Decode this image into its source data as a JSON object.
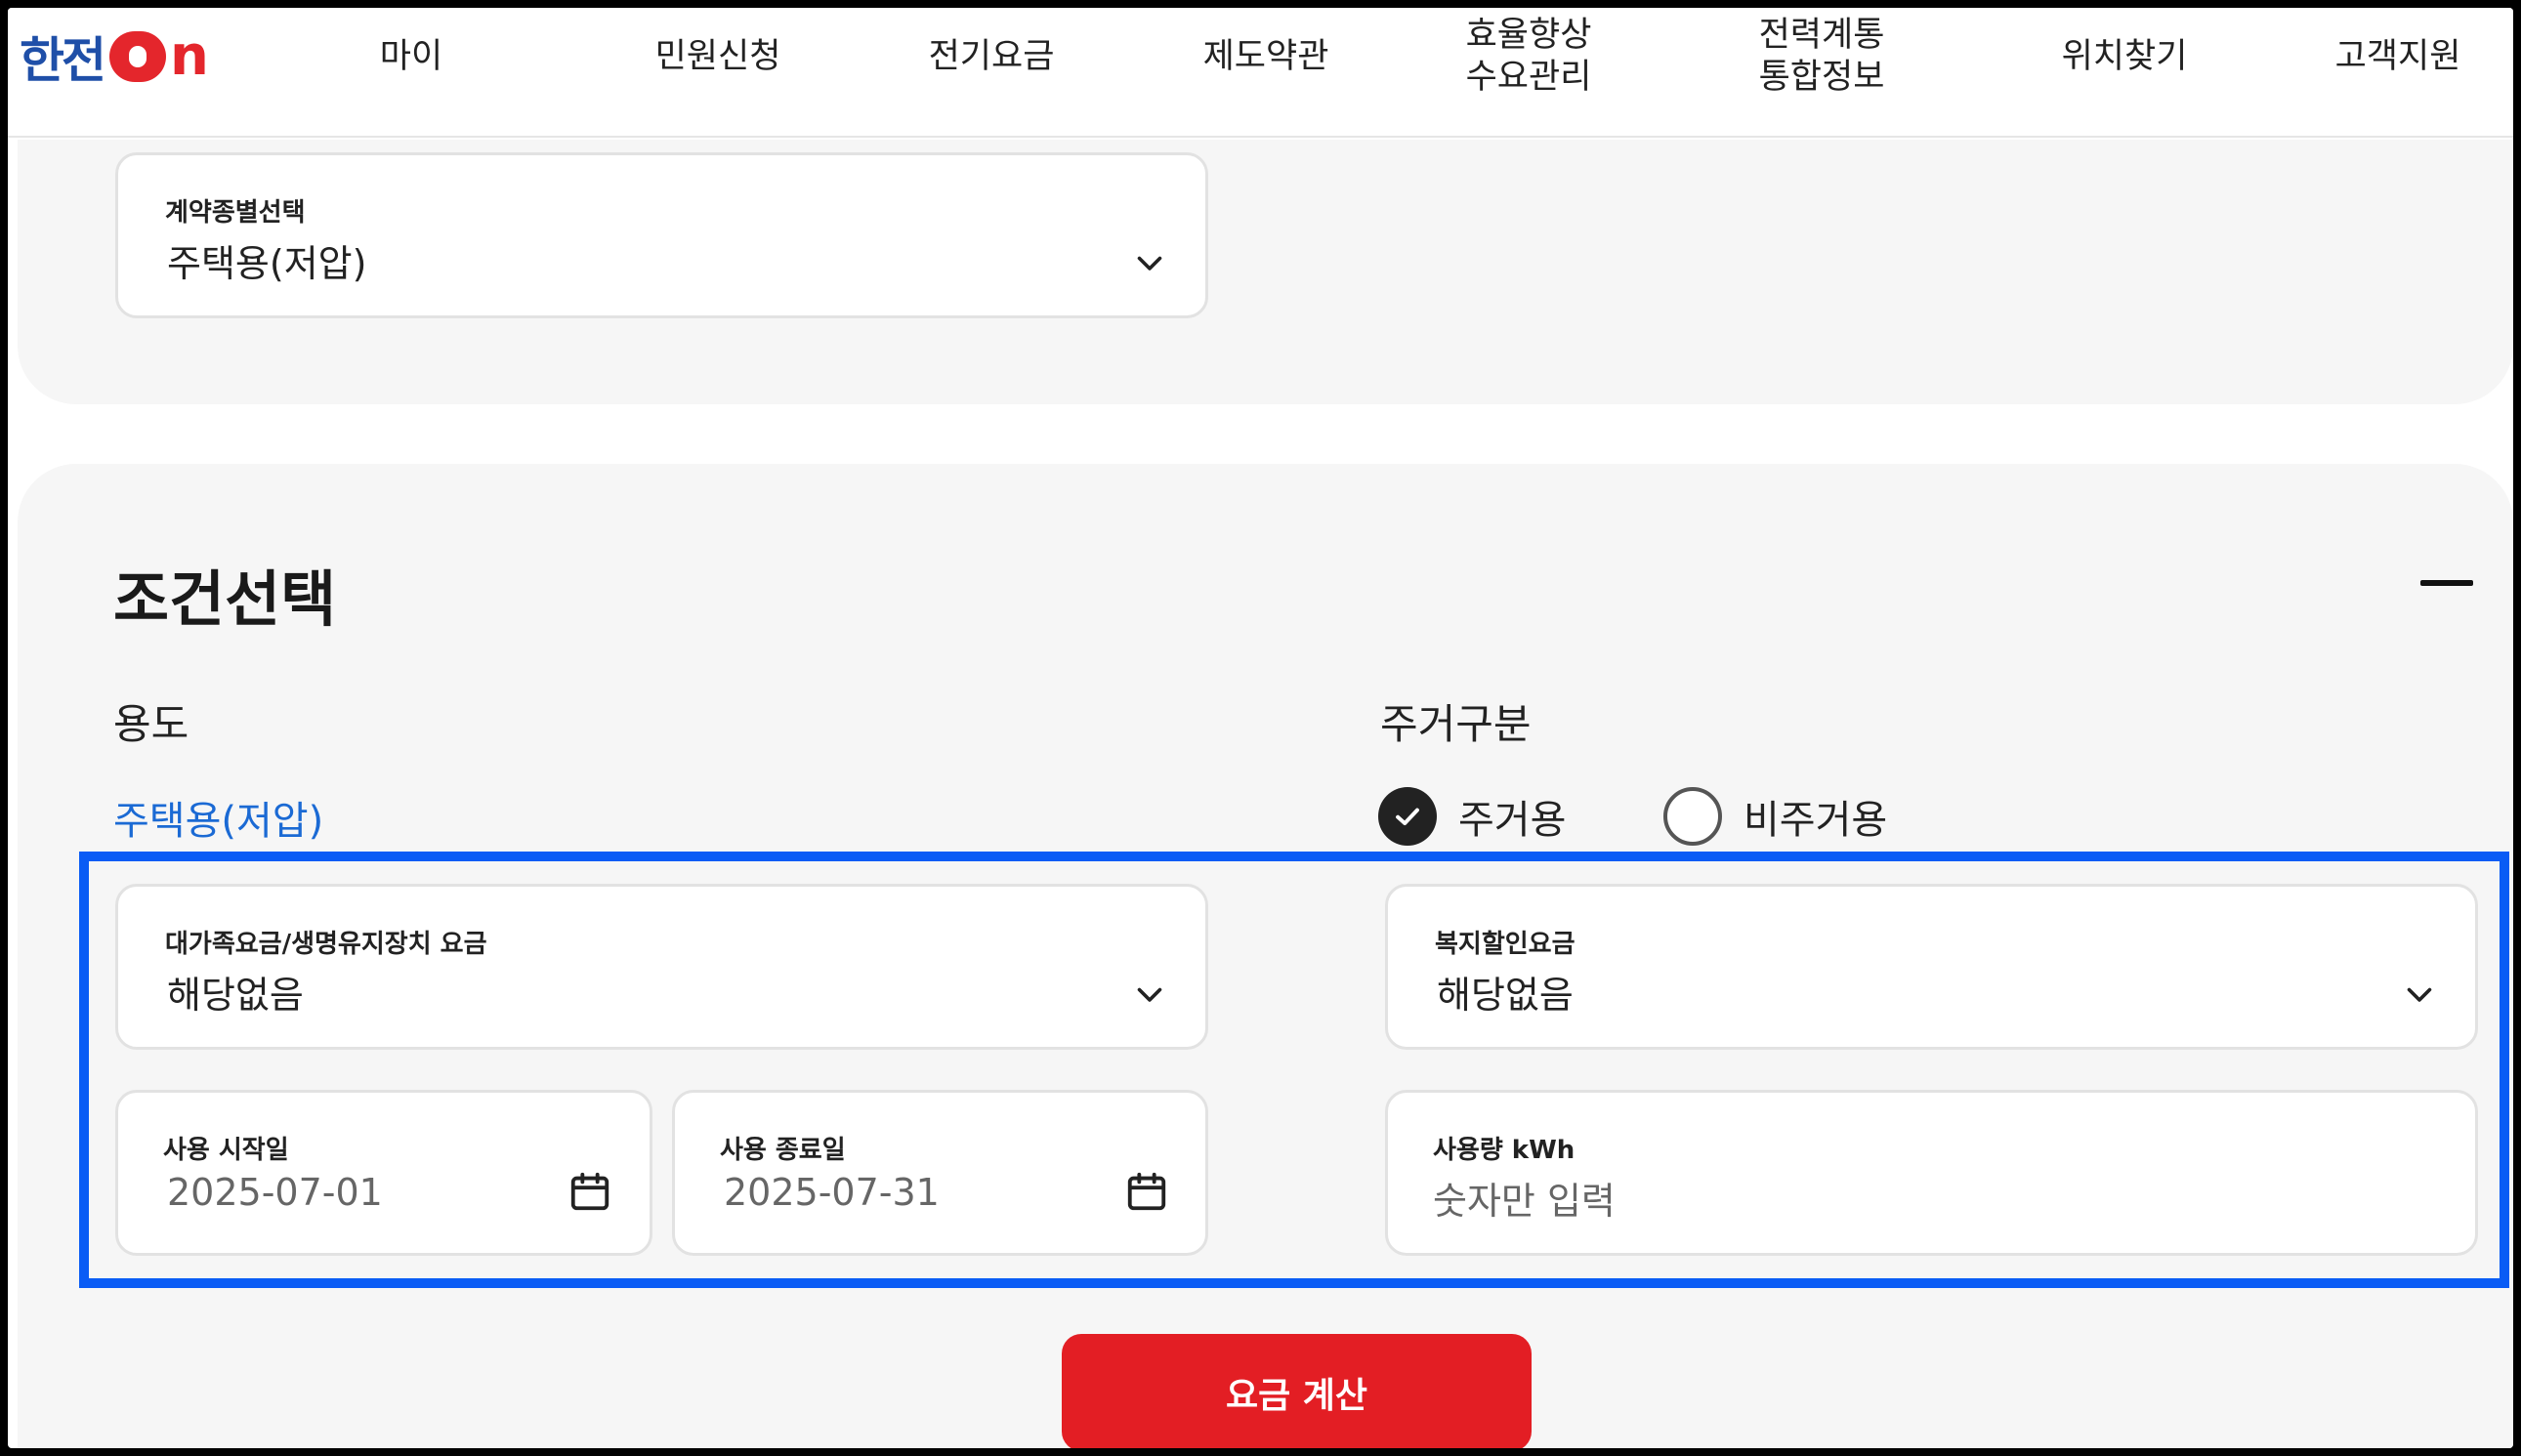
{
  "brand": {
    "logo_text": "한전ON"
  },
  "nav": {
    "items": [
      {
        "label": "마이"
      },
      {
        "label": "민원신청"
      },
      {
        "label": "전기요금"
      },
      {
        "label": "제도약관"
      },
      {
        "label": "효율향상\n수요관리"
      },
      {
        "label": "전력계통\n통합정보"
      },
      {
        "label": "위치찾기"
      },
      {
        "label": "고객지원"
      }
    ]
  },
  "contract": {
    "label": "계약종별선택",
    "value": "주택용(저압)"
  },
  "conditions": {
    "title": "조건선택",
    "usage_label": "용도",
    "usage_value": "주택용(저압)",
    "residence_label": "주거구분",
    "residence_options": [
      {
        "label": "주거용",
        "checked": true
      },
      {
        "label": "비주거용",
        "checked": false
      }
    ],
    "family_fee": {
      "label": "대가족요금/생명유지장치 요금",
      "value": "해당없음"
    },
    "welfare_fee": {
      "label": "복지할인요금",
      "value": "해당없음"
    },
    "start_date": {
      "label": "사용 시작일",
      "value": "2025-07-01"
    },
    "end_date": {
      "label": "사용 종료일",
      "value": "2025-07-31"
    },
    "usage_kwh": {
      "label": "사용량 kWh",
      "placeholder": "숫자만 입력"
    },
    "calc_button": "요금 계산"
  },
  "colors": {
    "accent_blue": "#1b6ad4",
    "highlight_blue": "#0a5cf5",
    "button_red": "#e31e24",
    "brand_red": "#e4262c",
    "brand_blue": "#1f4fa8"
  }
}
